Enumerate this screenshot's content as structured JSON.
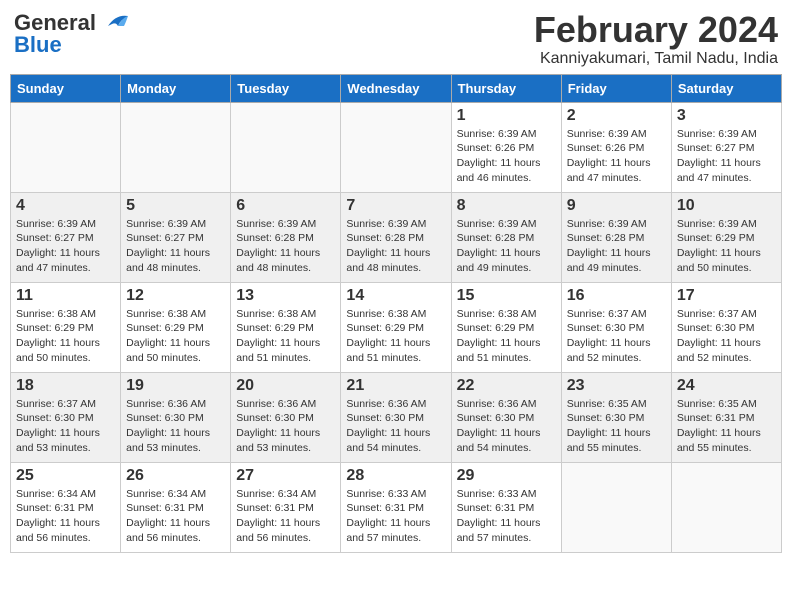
{
  "header": {
    "logo_general": "General",
    "logo_blue": "Blue",
    "month_title": "February 2024",
    "subtitle": "Kanniyakumari, Tamil Nadu, India"
  },
  "weekdays": [
    "Sunday",
    "Monday",
    "Tuesday",
    "Wednesday",
    "Thursday",
    "Friday",
    "Saturday"
  ],
  "weeks": [
    [
      {
        "num": "",
        "info": ""
      },
      {
        "num": "",
        "info": ""
      },
      {
        "num": "",
        "info": ""
      },
      {
        "num": "",
        "info": ""
      },
      {
        "num": "1",
        "info": "Sunrise: 6:39 AM\nSunset: 6:26 PM\nDaylight: 11 hours\nand 46 minutes."
      },
      {
        "num": "2",
        "info": "Sunrise: 6:39 AM\nSunset: 6:26 PM\nDaylight: 11 hours\nand 47 minutes."
      },
      {
        "num": "3",
        "info": "Sunrise: 6:39 AM\nSunset: 6:27 PM\nDaylight: 11 hours\nand 47 minutes."
      }
    ],
    [
      {
        "num": "4",
        "info": "Sunrise: 6:39 AM\nSunset: 6:27 PM\nDaylight: 11 hours\nand 47 minutes."
      },
      {
        "num": "5",
        "info": "Sunrise: 6:39 AM\nSunset: 6:27 PM\nDaylight: 11 hours\nand 48 minutes."
      },
      {
        "num": "6",
        "info": "Sunrise: 6:39 AM\nSunset: 6:28 PM\nDaylight: 11 hours\nand 48 minutes."
      },
      {
        "num": "7",
        "info": "Sunrise: 6:39 AM\nSunset: 6:28 PM\nDaylight: 11 hours\nand 48 minutes."
      },
      {
        "num": "8",
        "info": "Sunrise: 6:39 AM\nSunset: 6:28 PM\nDaylight: 11 hours\nand 49 minutes."
      },
      {
        "num": "9",
        "info": "Sunrise: 6:39 AM\nSunset: 6:28 PM\nDaylight: 11 hours\nand 49 minutes."
      },
      {
        "num": "10",
        "info": "Sunrise: 6:39 AM\nSunset: 6:29 PM\nDaylight: 11 hours\nand 50 minutes."
      }
    ],
    [
      {
        "num": "11",
        "info": "Sunrise: 6:38 AM\nSunset: 6:29 PM\nDaylight: 11 hours\nand 50 minutes."
      },
      {
        "num": "12",
        "info": "Sunrise: 6:38 AM\nSunset: 6:29 PM\nDaylight: 11 hours\nand 50 minutes."
      },
      {
        "num": "13",
        "info": "Sunrise: 6:38 AM\nSunset: 6:29 PM\nDaylight: 11 hours\nand 51 minutes."
      },
      {
        "num": "14",
        "info": "Sunrise: 6:38 AM\nSunset: 6:29 PM\nDaylight: 11 hours\nand 51 minutes."
      },
      {
        "num": "15",
        "info": "Sunrise: 6:38 AM\nSunset: 6:29 PM\nDaylight: 11 hours\nand 51 minutes."
      },
      {
        "num": "16",
        "info": "Sunrise: 6:37 AM\nSunset: 6:30 PM\nDaylight: 11 hours\nand 52 minutes."
      },
      {
        "num": "17",
        "info": "Sunrise: 6:37 AM\nSunset: 6:30 PM\nDaylight: 11 hours\nand 52 minutes."
      }
    ],
    [
      {
        "num": "18",
        "info": "Sunrise: 6:37 AM\nSunset: 6:30 PM\nDaylight: 11 hours\nand 53 minutes."
      },
      {
        "num": "19",
        "info": "Sunrise: 6:36 AM\nSunset: 6:30 PM\nDaylight: 11 hours\nand 53 minutes."
      },
      {
        "num": "20",
        "info": "Sunrise: 6:36 AM\nSunset: 6:30 PM\nDaylight: 11 hours\nand 53 minutes."
      },
      {
        "num": "21",
        "info": "Sunrise: 6:36 AM\nSunset: 6:30 PM\nDaylight: 11 hours\nand 54 minutes."
      },
      {
        "num": "22",
        "info": "Sunrise: 6:36 AM\nSunset: 6:30 PM\nDaylight: 11 hours\nand 54 minutes."
      },
      {
        "num": "23",
        "info": "Sunrise: 6:35 AM\nSunset: 6:30 PM\nDaylight: 11 hours\nand 55 minutes."
      },
      {
        "num": "24",
        "info": "Sunrise: 6:35 AM\nSunset: 6:31 PM\nDaylight: 11 hours\nand 55 minutes."
      }
    ],
    [
      {
        "num": "25",
        "info": "Sunrise: 6:34 AM\nSunset: 6:31 PM\nDaylight: 11 hours\nand 56 minutes."
      },
      {
        "num": "26",
        "info": "Sunrise: 6:34 AM\nSunset: 6:31 PM\nDaylight: 11 hours\nand 56 minutes."
      },
      {
        "num": "27",
        "info": "Sunrise: 6:34 AM\nSunset: 6:31 PM\nDaylight: 11 hours\nand 56 minutes."
      },
      {
        "num": "28",
        "info": "Sunrise: 6:33 AM\nSunset: 6:31 PM\nDaylight: 11 hours\nand 57 minutes."
      },
      {
        "num": "29",
        "info": "Sunrise: 6:33 AM\nSunset: 6:31 PM\nDaylight: 11 hours\nand 57 minutes."
      },
      {
        "num": "",
        "info": ""
      },
      {
        "num": "",
        "info": ""
      }
    ]
  ]
}
